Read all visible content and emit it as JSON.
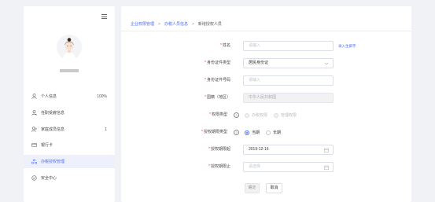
{
  "sidebar": {
    "items": [
      {
        "icon": "user-icon",
        "label": "个人信息",
        "count": "100%"
      },
      {
        "icon": "user-role-icon",
        "label": "任职受雇信息",
        "count": ""
      },
      {
        "icon": "family-icon",
        "label": "家庭成员信息",
        "count": "1"
      },
      {
        "icon": "bank-card-icon",
        "label": "银行卡",
        "count": ""
      },
      {
        "icon": "authorization-icon",
        "label": "办税授权管理",
        "count": ""
      },
      {
        "icon": "security-icon",
        "label": "安全中心",
        "count": ""
      }
    ]
  },
  "breadcrumb": {
    "items": [
      "企业权限管理",
      "办税人员信息",
      "新增授权人员"
    ]
  },
  "form": {
    "name": {
      "label": "姓名",
      "placeholder": "请输入",
      "link": "录入生僻字"
    },
    "id_type": {
      "label": "身份证件类型",
      "value": "居民身份证"
    },
    "id_number": {
      "label": "身份证件号码",
      "placeholder": "请输入"
    },
    "nationality": {
      "label": "国籍（地区）",
      "value": "中华人民共和国"
    },
    "auth_type": {
      "label": "权限类型",
      "options": [
        "办税权限",
        "管理权限"
      ]
    },
    "period_type": {
      "label": "授权期限类型",
      "options": [
        "当期",
        "长期"
      ],
      "selected": "当期"
    },
    "start_date": {
      "label": "授权期限起",
      "value": "2019-12-16"
    },
    "end_date": {
      "label": "授权期限止",
      "placeholder": "请选择"
    },
    "confirm_label": "确定",
    "cancel_label": "取消"
  },
  "colors": {
    "accent": "#4a6cf7",
    "required": "#ff3333",
    "background": "#f0f2f5"
  }
}
